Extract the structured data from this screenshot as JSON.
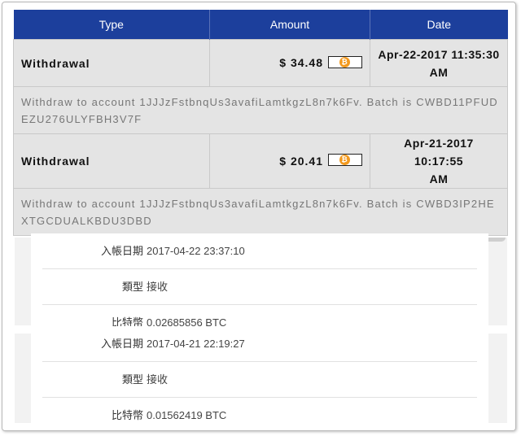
{
  "table": {
    "headers": {
      "type": "Type",
      "amount": "Amount",
      "date": "Date"
    },
    "rows": [
      {
        "type": "Withdrawal",
        "amount": "$ 34.48",
        "date_line1": "Apr-22-2017 11:35:30",
        "date_line2": "AM",
        "description": "Withdraw to account 1JJJzFstbnqUs3avafiLamtkgzL8n7k6Fv. Batch is CWBD11PFUDEZU276ULYFBH3V7F"
      },
      {
        "type": "Withdrawal",
        "amount": "$ 20.41",
        "date_line1": "Apr-21-2017 10:17:55",
        "date_line2": "AM",
        "description": "Withdraw to account 1JJJzFstbnqUs3avafiLamtkgzL8n7k6Fv. Batch is CWBD3IP2HEXTGCDUALKBDU3DBD"
      }
    ],
    "coin_icon": "bitcoin-icon",
    "coin_glyph": "₿"
  },
  "details": [
    {
      "date_label": "入帳日期",
      "date_value": "2017-04-22 23:37:10",
      "type_label": "類型",
      "type_value": "接收",
      "coin_label": "比特幣",
      "coin_value": "0.02685856 BTC"
    },
    {
      "date_label": "入帳日期",
      "date_value": "2017-04-21 22:19:27",
      "type_label": "類型",
      "type_value": "接收",
      "coin_label": "比特幣",
      "coin_value": "0.01562419 BTC"
    }
  ],
  "colors": {
    "header_bg": "#1c3f9c",
    "row_bg": "#e4e4e4",
    "coin": "#f39a1f",
    "panel_bg": "#f2f2f2"
  }
}
